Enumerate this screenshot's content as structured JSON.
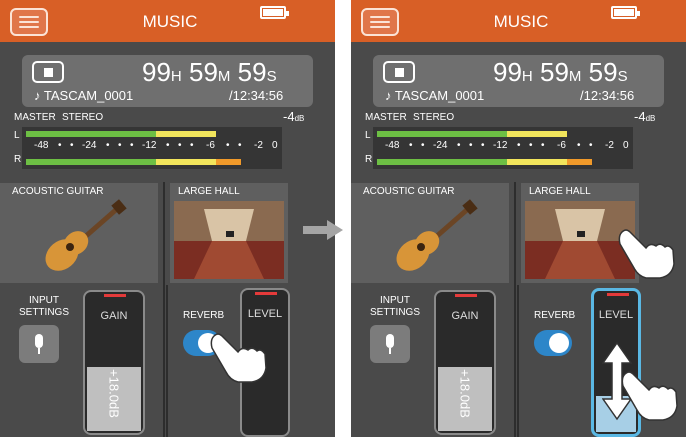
{
  "screens": [
    {
      "app_title": "MUSIC",
      "counter": {
        "h": "99",
        "h_unit": "H",
        "m": "59",
        "m_unit": "M",
        "s": "59",
        "s_unit": "S"
      },
      "file_name": "♪ TASCAM_0001",
      "remaining": "/12:34:56",
      "meter": {
        "master_label": "MASTER",
        "mode_label": "STEREO",
        "peak_db": "-4",
        "peak_unit": "dB",
        "l_label": "L",
        "r_label": "R",
        "scale": [
          "-48",
          "-24",
          "-12",
          "-6",
          "-2",
          "0"
        ]
      },
      "source_label": "ACOUSTIC GUITAR",
      "effect_label": "LARGE HALL",
      "input_settings_label": "INPUT\nSETTINGS",
      "gain_label": "GAIN",
      "gain_value": "+18.0dB",
      "reverb_label": "REVERB",
      "reverb_on": true,
      "level_label": "LEVEL",
      "level_selected": false
    },
    {
      "app_title": "MUSIC",
      "counter": {
        "h": "99",
        "h_unit": "H",
        "m": "59",
        "m_unit": "M",
        "s": "59",
        "s_unit": "S"
      },
      "file_name": "♪ TASCAM_0001",
      "remaining": "/12:34:56",
      "meter": {
        "master_label": "MASTER",
        "mode_label": "STEREO",
        "peak_db": "-4",
        "peak_unit": "dB",
        "l_label": "L",
        "r_label": "R",
        "scale": [
          "-48",
          "-24",
          "-12",
          "-6",
          "-2",
          "0"
        ]
      },
      "source_label": "ACOUSTIC GUITAR",
      "effect_label": "LARGE HALL",
      "input_settings_label": "INPUT\nSETTINGS",
      "gain_label": "GAIN",
      "gain_value": "+18.0dB",
      "reverb_label": "REVERB",
      "reverb_on": true,
      "level_label": "LEVEL",
      "level_selected": true
    }
  ],
  "colors": {
    "topbar": "#d85f26",
    "meter_green": "#6dbf44",
    "meter_yellow": "#f2e55c",
    "meter_orange": "#f19a2a",
    "toggle_on": "#2d86c9",
    "selected": "#5ab8e4"
  },
  "icons": {
    "menu": "hamburger-icon",
    "battery": "battery-icon",
    "stop": "stop-icon",
    "mic": "microphone-icon",
    "hand": "pointing-hand-icon",
    "next": "right-arrow-icon"
  }
}
